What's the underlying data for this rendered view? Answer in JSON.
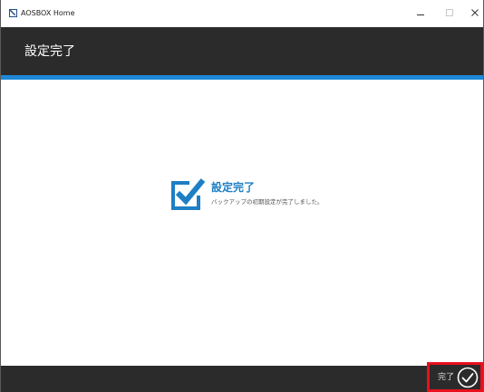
{
  "window": {
    "app_title": "AOSBOX Home"
  },
  "header": {
    "title": "設定完了"
  },
  "message": {
    "title": "設定完了",
    "body": "バックアップの初期設定が完了しました。"
  },
  "footer": {
    "finish_label": "完了"
  },
  "colors": {
    "accent": "#1e88d8",
    "header_bg": "#2b2b2b",
    "highlight_border": "#e8101c",
    "message_title": "#1e7fc4"
  },
  "icons": {
    "app": "aosbox-logo-icon",
    "status": "checkbox-checked-icon",
    "finish": "check-circle-icon"
  }
}
